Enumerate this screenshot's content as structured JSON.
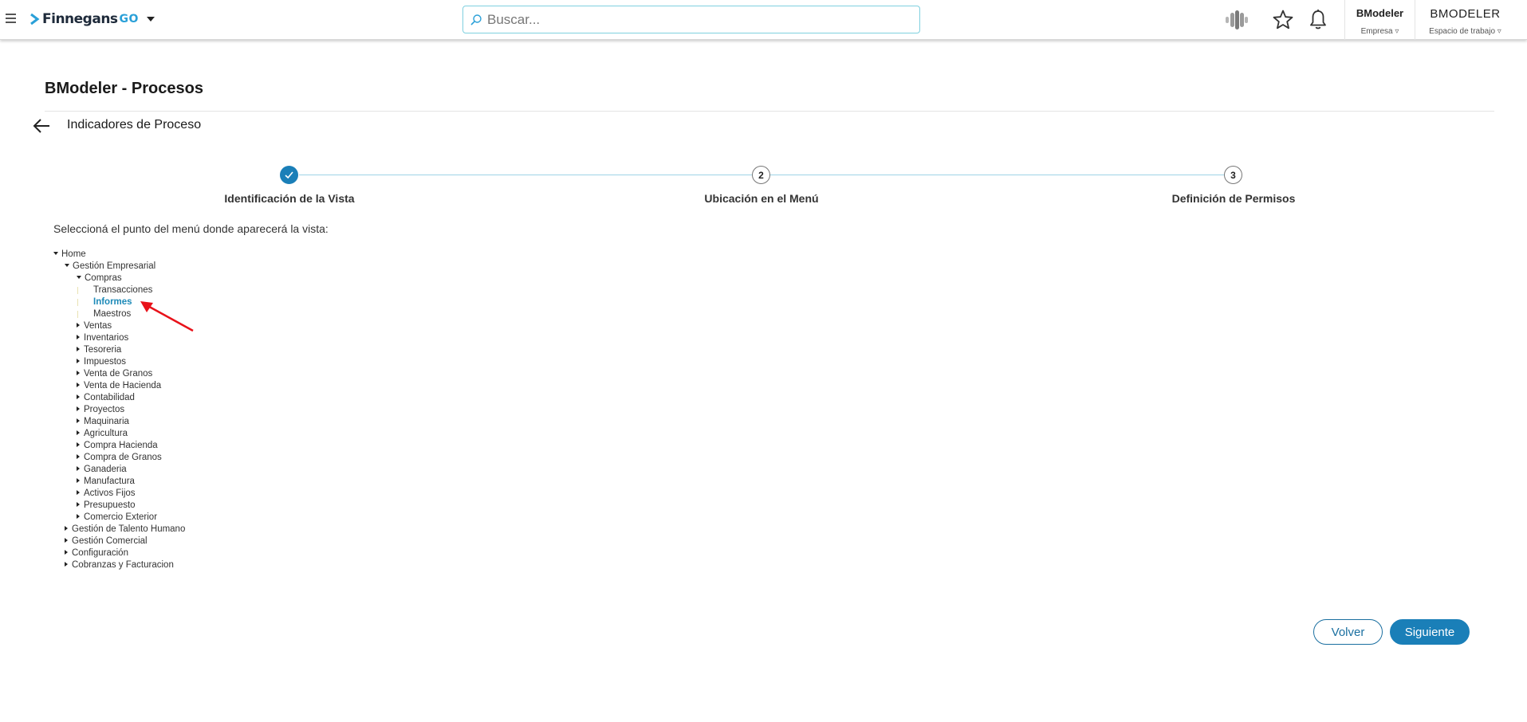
{
  "header": {
    "brand": "Finnegans",
    "brand_suffix": "GO",
    "search_placeholder": "Buscar...",
    "company": {
      "name": "BModeler",
      "label": "Empresa"
    },
    "workspace": {
      "name": "BMODELER",
      "label": "Espacio de trabajo"
    }
  },
  "page": {
    "title": "BModeler - Procesos",
    "subtitle": "Indicadores de Proceso"
  },
  "stepper": {
    "steps": [
      {
        "number": "1",
        "label": "Identificación de la Vista",
        "status": "done"
      },
      {
        "number": "2",
        "label": "Ubicación en el Menú",
        "status": "pending"
      },
      {
        "number": "3",
        "label": "Definición de Permisos",
        "status": "pending"
      }
    ]
  },
  "instruction": "Seleccioná el punto del menú donde aparecerá la vista:",
  "tree": [
    "Home",
    "Gestión Empresarial",
    "Compras",
    "Transacciones",
    "Informes",
    "Maestros",
    "Ventas",
    "Inventarios",
    "Tesoreria",
    "Impuestos",
    "Venta de Granos",
    "Venta de Hacienda",
    "Contabilidad",
    "Proyectos",
    "Maquinaria",
    "Agricultura",
    "Compra Hacienda",
    "Compra de Granos",
    "Ganaderia",
    "Manufactura",
    "Activos Fijos",
    "Presupuesto",
    "Comercio Exterior",
    "Gestión de Talento Humano",
    "Gestión Comercial",
    "Configuración",
    "Cobranzas y Facturacion"
  ],
  "selected_item": "Informes",
  "buttons": {
    "back": "Volver",
    "next": "Siguiente"
  },
  "colors": {
    "primary": "#1a7fb8",
    "selected_text": "#1d8ab8",
    "annotation": "#e8121a"
  }
}
